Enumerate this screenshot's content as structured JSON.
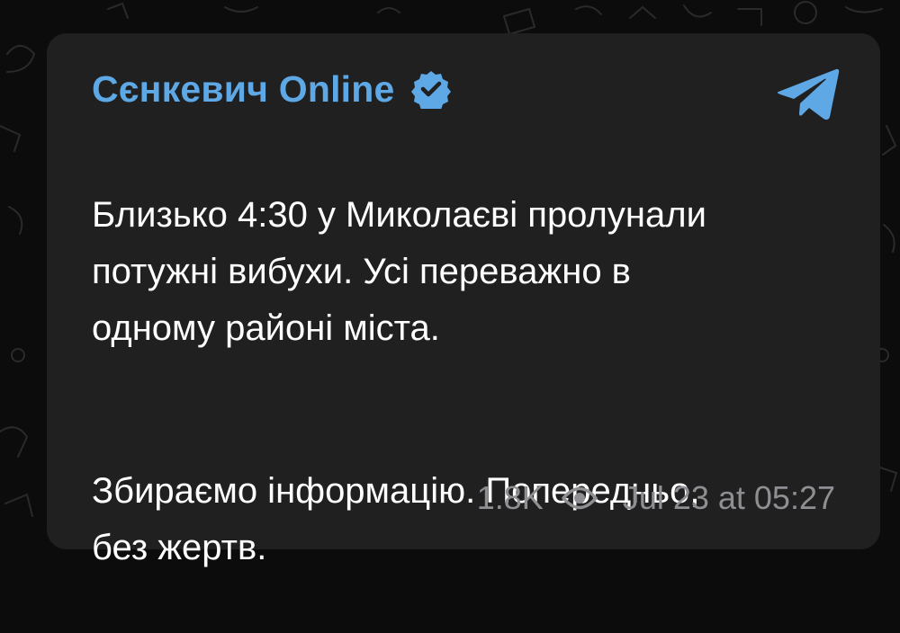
{
  "message": {
    "channel_name": "Сєнкевич Online",
    "paragraph_1": "Близько 4:30 у Миколаєві пролунали\nпотужні вибухи. Усі переважно в\nодному районі міста.",
    "paragraph_2": "Збираємо інформацію. Попередньо,\nбез жертв.",
    "views": "1.8K",
    "timestamp": "Jul 23 at 05:27"
  },
  "icons": {
    "verified": "verified-badge-icon",
    "telegram": "telegram-logo-icon",
    "views": "eye-icon"
  },
  "colors": {
    "background": "#0c0c0c",
    "bubble": "#202021",
    "accent": "#5ea8e6",
    "text": "#ffffff",
    "meta": "#8f8f93"
  }
}
